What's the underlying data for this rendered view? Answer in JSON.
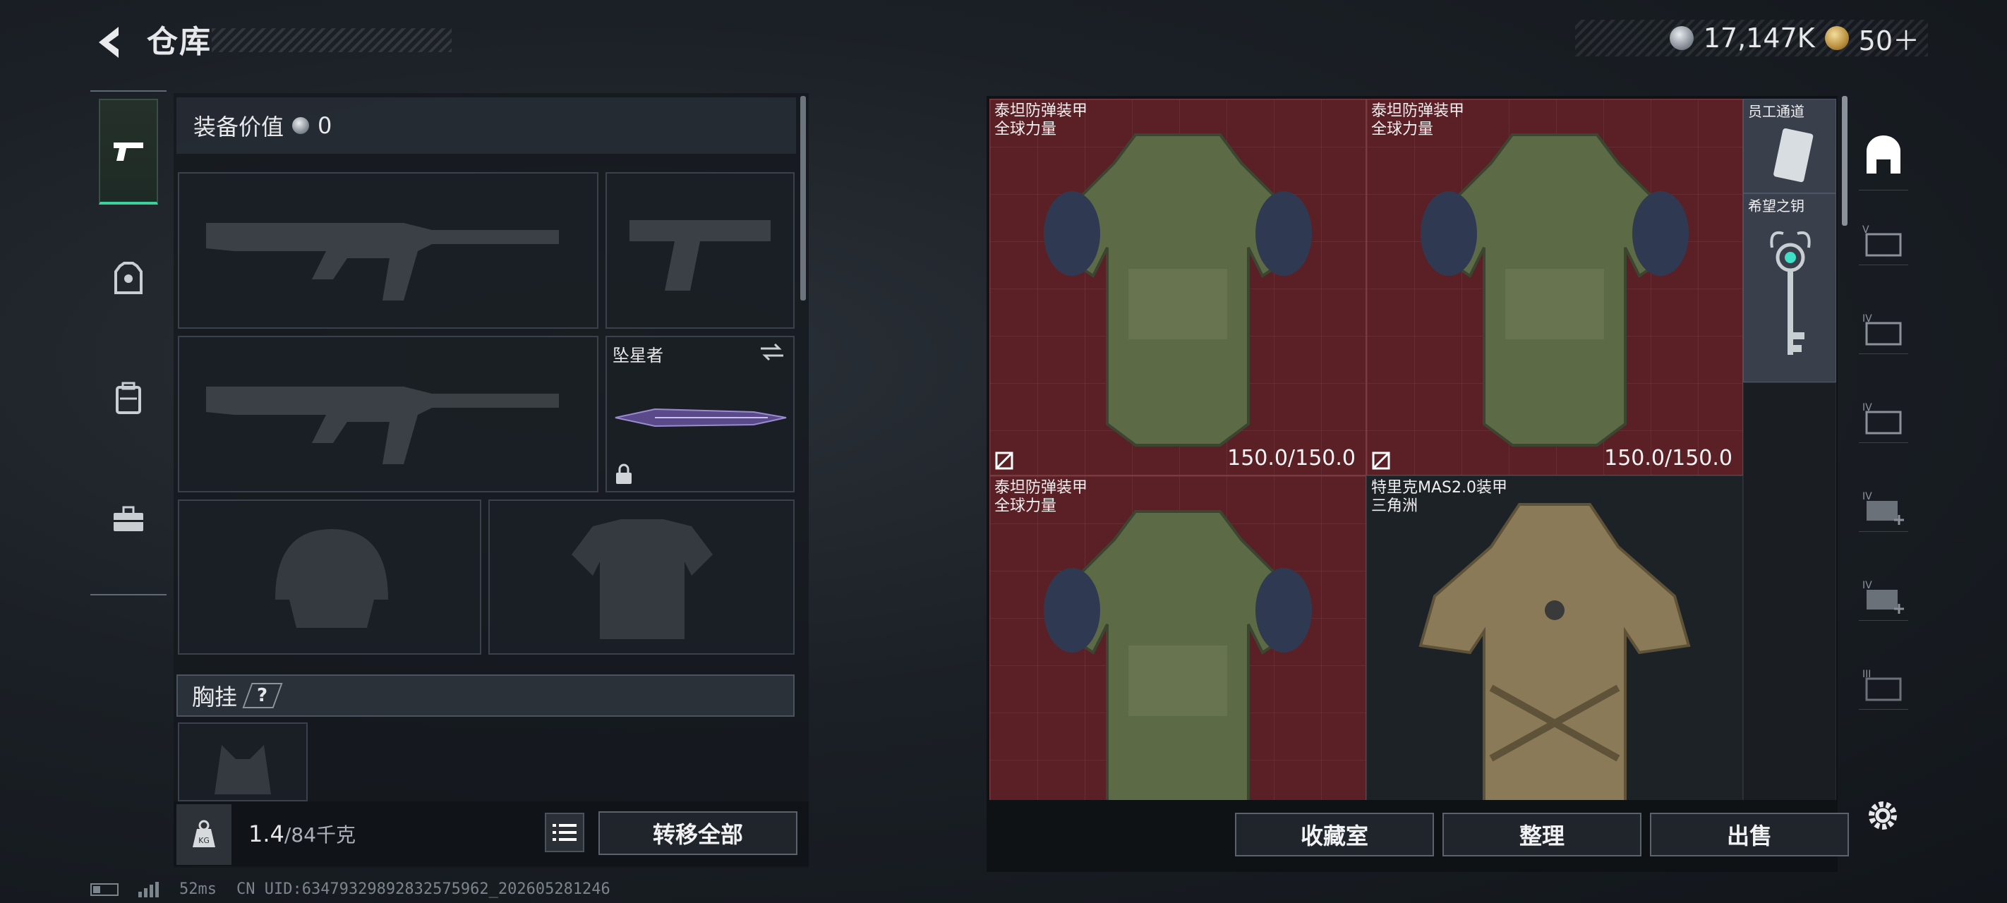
{
  "header": {
    "title": "仓库",
    "currency_silver": "17,147K",
    "currency_gold": "50＋"
  },
  "left_rail": [
    {
      "icon": "pistol-icon",
      "active": true
    },
    {
      "icon": "helmet-armor-icon",
      "active": false
    },
    {
      "icon": "backpack-icon",
      "active": false
    },
    {
      "icon": "toolbox-icon",
      "active": false
    }
  ],
  "equipment": {
    "value_label": "装备价值",
    "value": "0",
    "melee_name": "坠星者",
    "chest_rig_label": "胸挂",
    "help": "?"
  },
  "footer": {
    "weight_current": "1.4",
    "weight_capacity": "/84千克",
    "transfer_all": "转移全部"
  },
  "storage": {
    "items": [
      {
        "name": "泰坦防弹装甲",
        "sub": "全球力量",
        "durability": "150.0/150.0"
      },
      {
        "name": "泰坦防弹装甲",
        "sub": "全球力量",
        "durability": "150.0/150.0"
      },
      {
        "name": "泰坦防弹装甲",
        "sub": "全球力量",
        "durability": ""
      },
      {
        "name": "特里克MAS2.0装甲",
        "sub": "三角洲",
        "durability": ""
      }
    ],
    "small_items": [
      {
        "name": "员工通道"
      },
      {
        "name": "希望之钥"
      }
    ]
  },
  "bottom_actions": {
    "collection": "收藏室",
    "organize": "整理",
    "sell": "出售"
  },
  "status": {
    "ping": "52ms",
    "uid": "CN UID:63479329892832575962_202605281246"
  },
  "right_rail_labels": [
    "V",
    "IV",
    "IV",
    "IV",
    "IV",
    "III"
  ],
  "colors": {
    "accent_green": "#39d39a",
    "item_red_bg": "#5a2026"
  }
}
